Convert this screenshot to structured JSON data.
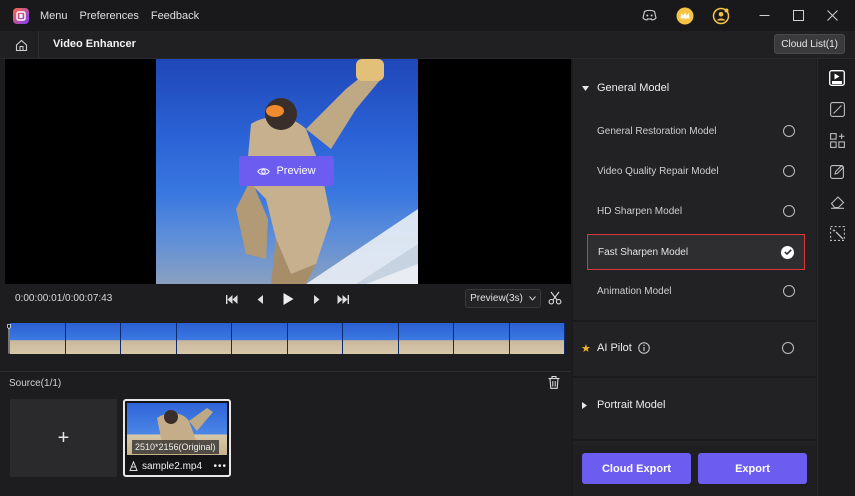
{
  "menu": {
    "items": [
      "Menu",
      "Preferences",
      "Feedback"
    ]
  },
  "titlebar": {
    "icons": [
      "discord-icon",
      "crown-icon",
      "account-icon"
    ],
    "window": [
      "minimize-icon",
      "maximize-icon",
      "close-icon"
    ]
  },
  "toolbar": {
    "title": "Video Enhancer",
    "cloud_list": "Cloud List(1)"
  },
  "player": {
    "preview_label": "Preview",
    "timecode": "0:00:00:01/0:00:07:43",
    "preview_select": "Preview(3s)"
  },
  "source": {
    "title": "Source(1/1)",
    "add_label": "+",
    "file": {
      "resolution": "2510*2156(Original)",
      "name": "sample2.mp4",
      "more": "•••"
    }
  },
  "panel": {
    "general_model": "General Model",
    "models": [
      {
        "label": "General Restoration Model",
        "selected": false
      },
      {
        "label": "Video Quality Repair Model",
        "selected": false
      },
      {
        "label": "HD Sharpen Model",
        "selected": false
      },
      {
        "label": "Fast Sharpen Model",
        "selected": true
      },
      {
        "label": "Animation Model",
        "selected": false
      }
    ],
    "ai_pilot": "AI Pilot",
    "portrait_model": "Portrait Model",
    "cloud_export": "Cloud Export",
    "export": "Export"
  },
  "colors": {
    "accent": "#6d5cf0",
    "selected_border": "#d33a3a",
    "star": "#f0b429"
  }
}
